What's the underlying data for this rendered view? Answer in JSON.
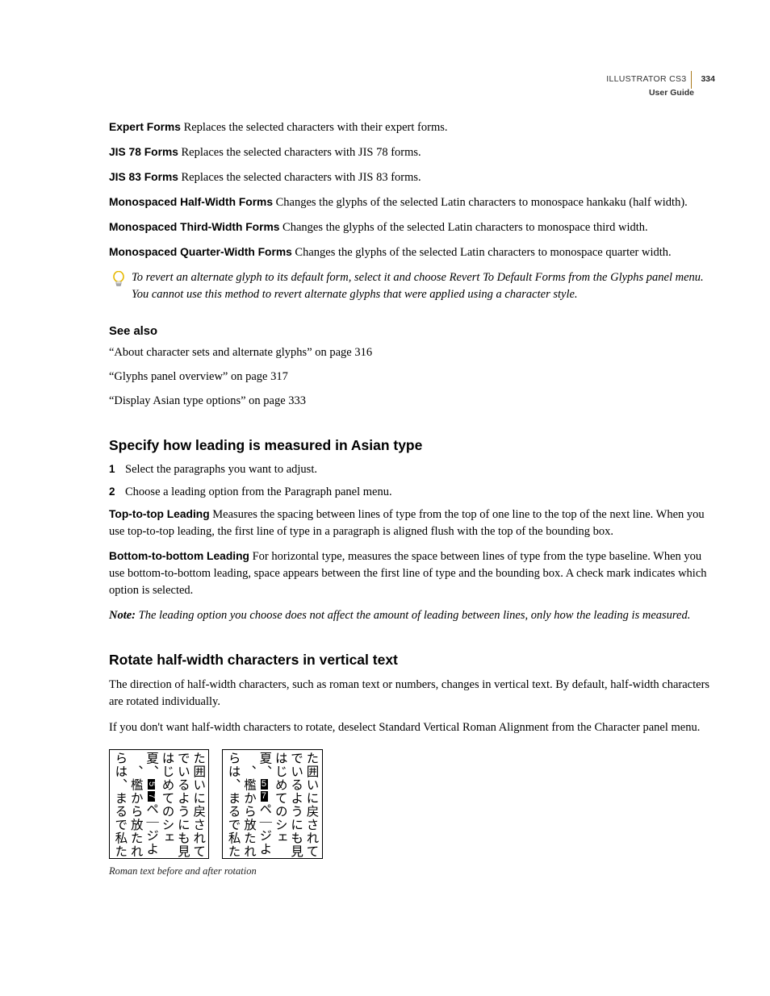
{
  "header": {
    "product": "ILLUSTRATOR CS3",
    "page_number": "334",
    "subtitle": "User Guide"
  },
  "defs": [
    {
      "term": "Expert Forms",
      "text": " Replaces the selected characters with their expert forms."
    },
    {
      "term": "JIS 78 Forms",
      "text": " Replaces the selected characters with JIS 78 forms."
    },
    {
      "term": "JIS 83 Forms",
      "text": " Replaces the selected characters with JIS 83 forms."
    },
    {
      "term": "Monospaced Half-Width Forms",
      "text": " Changes the glyphs of the selected Latin characters to monospace hankaku (half width)."
    },
    {
      "term": "Monospaced Third-Width Forms",
      "text": " Changes the glyphs of the selected Latin characters to monospace third width."
    },
    {
      "term": "Monospaced Quarter-Width Forms",
      "text": " Changes the glyphs of the selected Latin characters to monospace quarter width."
    }
  ],
  "tip": "To revert an alternate glyph to its default form, select it and choose Revert To Default Forms from the Glyphs panel menu. You cannot use this method to revert alternate glyphs that were applied using a character style.",
  "see_also": {
    "heading": "See also",
    "items": [
      "“About character sets and alternate glyphs” on page 316",
      "“Glyphs panel overview” on page 317",
      "“Display Asian type options” on page 333"
    ]
  },
  "section_leading": {
    "heading": "Specify how leading is measured in Asian type",
    "steps": [
      "Select the paragraphs you want to adjust.",
      "Choose a leading option from the Paragraph panel menu."
    ],
    "defs": [
      {
        "term": "Top-to-top Leading",
        "text": " Measures the spacing between lines of type from the top of one line to the top of the next line. When you use top-to-top leading, the first line of type in a paragraph is aligned flush with the top of the bounding box."
      },
      {
        "term": "Bottom-to-bottom Leading",
        "text": " For horizontal type, measures the space between lines of type from the type baseline. When you use bottom-to-bottom leading, space appears between the first line of type and the bounding box. A check mark indicates which option is selected."
      }
    ],
    "note_label": "Note:",
    "note_text": " The leading option you choose does not affect the amount of leading between lines, only how the leading is measured."
  },
  "section_rotate": {
    "heading": "Rotate half-width characters in vertical text",
    "p1": "The direction of half-width characters, such as roman text or numbers, changes in vertical text. By default, half-width characters are rotated individually.",
    "p2": "If you don't want half-width characters to rotate, deselect Standard Vertical Roman Alignment from the Character panel menu.",
    "figure_caption": "Roman text before and after rotation",
    "jp_cols": [
      "た囲いに戻されて",
      "でいるようにも見",
      "はじめてのシェ",
      "夏、　ページよ",
      "　、檻から放たれた",
      "らは、まるで私た"
    ],
    "roman_digits": [
      "5",
      "7"
    ]
  }
}
